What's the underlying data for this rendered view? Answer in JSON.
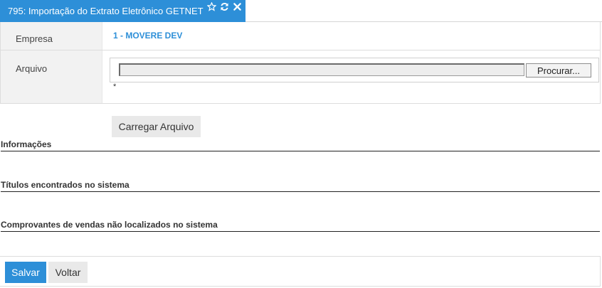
{
  "tab": {
    "title": "795: Importação do Extrato Eletrônico GETNET",
    "icons": [
      "star-icon",
      "refresh-icon",
      "close-icon"
    ]
  },
  "form": {
    "empresa_label": "Empresa",
    "empresa_value": "1 - MOVERE DEV",
    "arquivo_label": "Arquivo",
    "file_value": "",
    "browse_label": "Procurar...",
    "required_mark": "*"
  },
  "actions": {
    "load_label": "Carregar Arquivo"
  },
  "sections": {
    "informacoes": "Informações",
    "titulos": "Títulos encontrados no sistema",
    "comprovantes": "Comprovantes de vendas não localizados no sistema"
  },
  "footer": {
    "save_label": "Salvar",
    "back_label": "Voltar"
  },
  "colors": {
    "accent": "#2d8fd8",
    "label_bg": "#f2f2f2",
    "button_bg": "#e9e9e9"
  }
}
